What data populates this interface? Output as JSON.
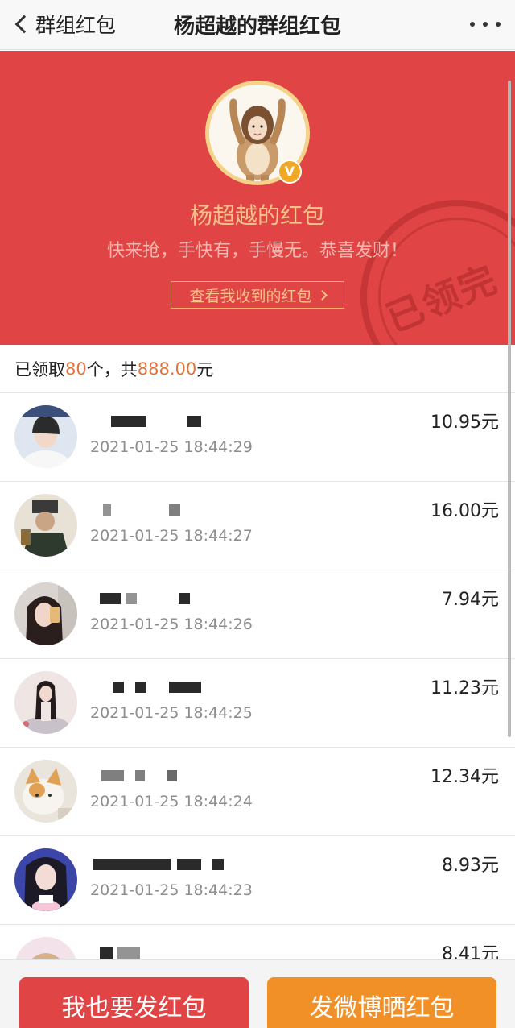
{
  "nav": {
    "back_label": "群组红包",
    "title": "杨超越的群组红包"
  },
  "hero": {
    "name": "杨超越的红包",
    "blessing": "快来抢，手快有，手慢无。恭喜发财！",
    "link_label": "查看我收到的红包",
    "stamp_text": "已领完",
    "badge": "V"
  },
  "summary": {
    "prefix": "已领取",
    "count": "80",
    "middle": "个，共",
    "total": "888.00",
    "suffix": "元"
  },
  "records": [
    {
      "time": "2021-01-25 18:44:29",
      "amount": "10.95元"
    },
    {
      "time": "2021-01-25 18:44:27",
      "amount": "16.00元"
    },
    {
      "time": "2021-01-25 18:44:26",
      "amount": "7.94元"
    },
    {
      "time": "2021-01-25 18:44:25",
      "amount": "11.23元"
    },
    {
      "time": "2021-01-25 18:44:24",
      "amount": "12.34元"
    },
    {
      "time": "2021-01-25 18:44:23",
      "amount": "8.93元"
    },
    {
      "time": "",
      "amount": "8.41元"
    }
  ],
  "buttons": {
    "send": "我也要发红包",
    "share": "发微博晒红包"
  },
  "colors": {
    "red": "#e04444",
    "orange": "#f29028",
    "highlight": "#e1733c",
    "gold": "#f6c28a"
  }
}
